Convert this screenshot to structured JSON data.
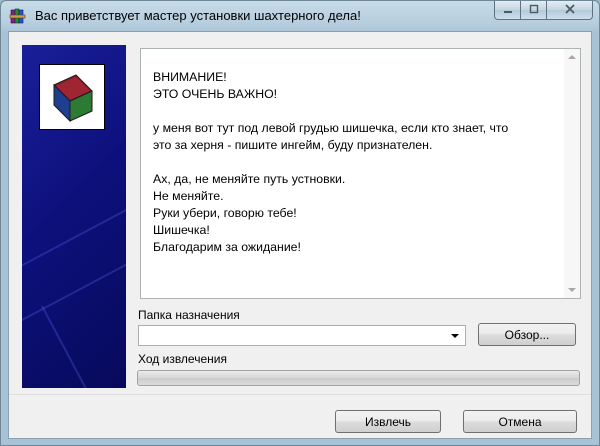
{
  "window": {
    "title": "Вас приветствует мастер установки шахтерного дела!"
  },
  "message": {
    "lines": [
      "ВНИМАНИЕ!",
      "ЭТО ОЧЕНЬ ВАЖНО!",
      "",
      "у меня вот тут под левой грудью шишечка, если кто знает, что",
      "это за херня - пишите ингейм, буду признателен.",
      "",
      "Ах, да, не меняйте путь устновки.",
      "Не меняйте.",
      "Руки убери, говорю тебе!",
      "Шишечка!",
      "Благодарим за ожидание!"
    ]
  },
  "destination": {
    "label": "Папка назначения",
    "value": "",
    "browse_label": "Обзор..."
  },
  "extraction": {
    "label": "Ход извлечения",
    "progress": 0
  },
  "buttons": {
    "extract_label": "Извлечь",
    "cancel_label": "Отмена"
  },
  "icons": {
    "app": "winrar-books-icon",
    "logo": "winrar-book-icon",
    "minimize": "minimize-icon",
    "maximize": "maximize-icon",
    "close": "close-icon"
  },
  "colors": {
    "banner": "#0d107c",
    "close_accent": "#c75050"
  }
}
